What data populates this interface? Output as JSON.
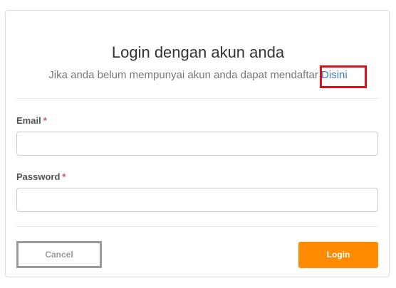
{
  "form": {
    "title": "Login dengan akun anda",
    "subtitle_text": "Jika anda belum mempunyai akun anda dapat mendaftar",
    "register_link": "Disini",
    "highlight_color": "#d8111a"
  },
  "fields": {
    "email": {
      "label": "Email",
      "required_marker": "*",
      "value": "",
      "placeholder": ""
    },
    "password": {
      "label": "Password",
      "required_marker": "*",
      "value": "",
      "placeholder": ""
    }
  },
  "actions": {
    "cancel_label": "Cancel",
    "login_label": "Login",
    "login_color": "#ff8c00"
  }
}
